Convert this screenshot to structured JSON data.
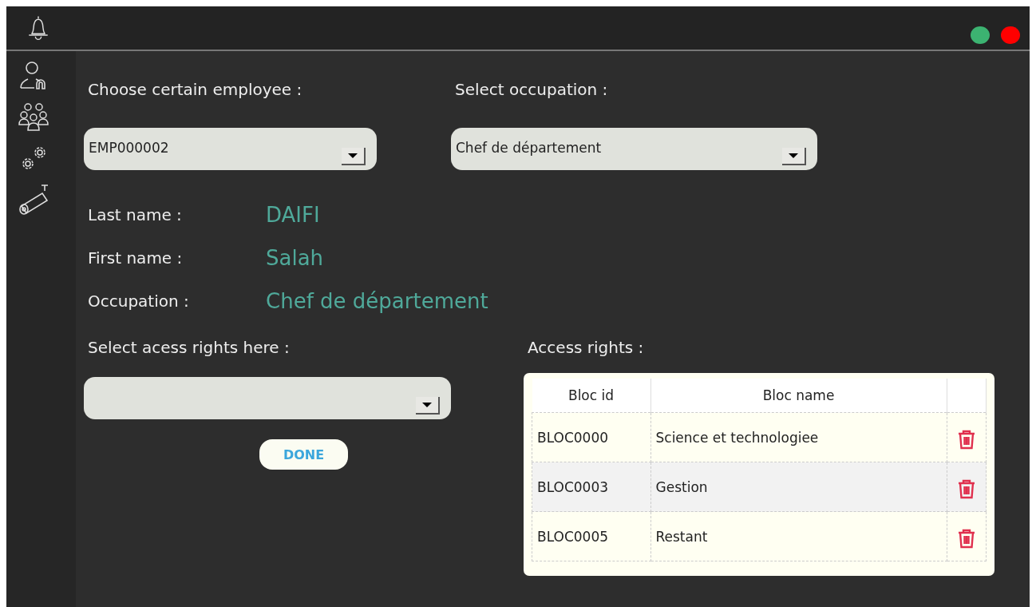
{
  "window": {
    "status_lights": [
      {
        "color": "#3cb371"
      },
      {
        "color": "#ff0000"
      }
    ]
  },
  "employee": {
    "label": "Choose certain employee :",
    "value": "EMP000002"
  },
  "occupation_select": {
    "label": "Select occupation :",
    "value": "Chef de département"
  },
  "details": [
    {
      "label": "Last name :",
      "value": "DAIFI"
    },
    {
      "label": "First name :",
      "value": "Salah"
    },
    {
      "label": "Occupation :",
      "value": "Chef de département"
    }
  ],
  "access_select": {
    "label": "Select acess rights here :"
  },
  "done_button": "DONE",
  "access_rights": {
    "label": "Access rights :",
    "columns": [
      "Bloc id",
      "Bloc name"
    ],
    "rows": [
      {
        "id": "BLOC0000",
        "name": "Science et technologiee",
        "selected": false
      },
      {
        "id": "BLOC0003",
        "name": "Gestion",
        "selected": true
      },
      {
        "id": "BLOC0005",
        "name": "Restant",
        "selected": false
      }
    ]
  }
}
